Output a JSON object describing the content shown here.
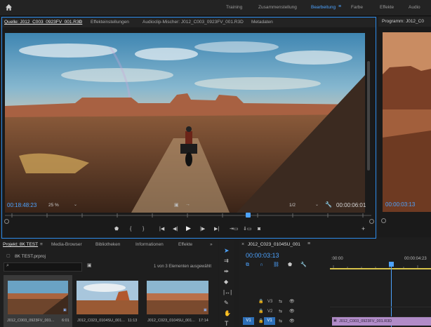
{
  "topbar": {
    "home_icon": "home-icon",
    "tabs": [
      {
        "label": "Training"
      },
      {
        "label": "Zusammenstellung"
      },
      {
        "label": "Bearbeitung",
        "active": true
      },
      {
        "label": "Farbe"
      },
      {
        "label": "Effekte"
      },
      {
        "label": "Audio"
      }
    ]
  },
  "source_panel": {
    "tabs": [
      {
        "label": "Quelle: J012_C003_0923FV_001.R3D",
        "active": true
      },
      {
        "label": "Effekteinstellungen"
      },
      {
        "label": "Audioclip-Mischer: J012_C003_0923FV_001.R3D"
      },
      {
        "label": "Metadaten"
      }
    ],
    "timecode_left": "00:18:48:23",
    "zoom": "25 %",
    "resolution": "1/2",
    "timecode_right": "00:00:06:01"
  },
  "program_panel": {
    "tab_label": "Programm: J012_C0",
    "timecode_left": "00:00:03:13"
  },
  "project_panel": {
    "tabs": [
      {
        "label": "Projekt: 8K TEST",
        "active": true
      },
      {
        "label": "Media-Browser"
      },
      {
        "label": "Bibliotheken"
      },
      {
        "label": "Informationen"
      },
      {
        "label": "Effekte"
      }
    ],
    "project_file": "8K TEST.prproj",
    "search_placeholder": "",
    "selection_info": "1 von 3 Elementen ausgewählt",
    "clips": [
      {
        "name": "J012_C003_0923FV_001...",
        "duration": "6:01"
      },
      {
        "name": "J012_C023_0104SU_001...",
        "duration": "11:13"
      },
      {
        "name": "J012_C023_0104SU_001...",
        "duration": "17:14"
      }
    ]
  },
  "timeline_panel": {
    "tab_label": "J012_C023_0104SU_001",
    "timecode": "00:00:03:13",
    "ruler_start": ":00:00",
    "ruler_mark": "00:00:04:23",
    "tracks": [
      {
        "label": "V3"
      },
      {
        "label": "V2"
      },
      {
        "label": "V1",
        "source": "V1"
      }
    ],
    "clip_label": "J012_C003_0923FV_001.R3D"
  },
  "colors": {
    "accent": "#2d8ceb",
    "timecode": "#4da3ff",
    "clip": "#b18cc8",
    "bg": "#1d1d1d"
  }
}
